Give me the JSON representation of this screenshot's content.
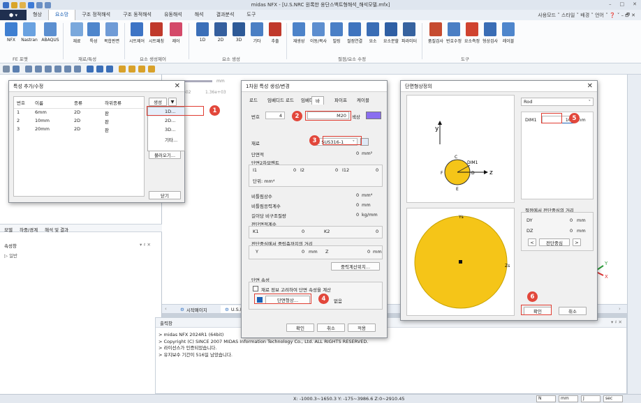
{
  "window": {
    "title": "midas NFX - [U.S.NRC 원록한 옹단스백트형해석_해석모델.mfx]",
    "controls": [
      "–",
      "□",
      "✕"
    ]
  },
  "menu": {
    "logo": "⬢ ▾",
    "tabs": [
      "형상",
      "요소망",
      "구조 정적해석",
      "구조 동적해석",
      "유동해석",
      "해석",
      "결과분석",
      "도구"
    ],
    "active": 1,
    "right": "사용모드 ˅ 스타일 ˅ 배경 ˅ 언어 ˅ ❓ ˅ – 🗗 ✕"
  },
  "ribbon": {
    "buttons": [
      {
        "label": "NFX"
      },
      {
        "label": "Nastran"
      },
      {
        "label": "ABAQUS"
      },
      {
        "label": "재료"
      },
      {
        "label": "특성"
      },
      {
        "label": "복합판면"
      },
      {
        "label": "시트제어"
      },
      {
        "label": "시트패칭"
      },
      {
        "label": "제어"
      },
      {
        "label": "1D"
      },
      {
        "label": "2D"
      },
      {
        "label": "3D"
      },
      {
        "label": "기타"
      },
      {
        "label": "추출"
      },
      {
        "label": "재생성"
      },
      {
        "label": "이동/복사"
      },
      {
        "label": "빌링"
      },
      {
        "label": "절점연결"
      },
      {
        "label": "요소"
      },
      {
        "label": "요소분할"
      },
      {
        "label": "파라미터"
      },
      {
        "label": "품질검사"
      },
      {
        "label": "번호수정"
      },
      {
        "label": "요소측정"
      },
      {
        "label": "형상검사"
      },
      {
        "label": "레이블"
      }
    ],
    "groups": [
      "FE 포맷",
      "재료/특성",
      "요소 생성제어",
      "요소 생성",
      "절점/요소 수정",
      "도구"
    ]
  },
  "left_panel": {
    "tabs": [
      "모델",
      "하중/경계",
      "해석 및 결과"
    ],
    "tree_header": "속성창",
    "tree_items": [
      "일반"
    ],
    "scale_text": "602",
    "scale_value": "1.36e+03",
    "units_hint": "mm"
  },
  "doc_tabs": [
    "시작페이지",
    "U.S.NRC"
  ],
  "output": {
    "header": "출력창",
    "lines": [
      "> midas NFX 2024R1 (64bit)",
      "> Copyright (C) SINCE 2007 MIDAS Information Technology Co., Ltd. ALL RIGHTS RESERVED.",
      "> 라이선스가 인증되었습니다.",
      "> 유지보수 기간이 516일 남았습니다."
    ]
  },
  "status": {
    "coords": "X: -1000.3~1650.3 Y: -175~3986.6 Z:0~2910.45",
    "unit_n": "N",
    "unit_mm": "mm",
    "unit_j": "J",
    "unit_sec": "sec"
  },
  "dlg1": {
    "title": "특성 추가/수정",
    "columns": [
      "번호",
      "이름",
      "종류",
      "하위종류"
    ],
    "rows": [
      {
        "no": "1",
        "name": "6mm",
        "type": "2D",
        "sub": "판"
      },
      {
        "no": "2",
        "name": "10mm",
        "type": "2D",
        "sub": "판"
      },
      {
        "no": "3",
        "name": "20mm",
        "type": "2D",
        "sub": "판"
      }
    ],
    "create_label": "생성",
    "create_arrow": "▼",
    "menu_items": [
      "1D...",
      "2D...",
      "3D...",
      "기타..."
    ],
    "load_label": "불러오기...",
    "close_label": "닫기"
  },
  "dlg2": {
    "title": "1차원 특성 생성/변경",
    "tabs": [
      "로드",
      "임베디드 로드",
      "임베디드 바",
      "파이프",
      "케이블"
    ],
    "active_tab": "바",
    "num_label": "번호",
    "num_value": "4",
    "name_value": "M20",
    "color_label": "색상",
    "material_label": "재료",
    "material_value": "2: SUS316-1",
    "area_label": "단면적",
    "area_value": "0",
    "area_unit": "mm²",
    "moment_title": "단면2차모멘트",
    "i1": "I1",
    "i1v": "0",
    "i2": "I2",
    "i2v": "0",
    "i12": "I12",
    "i12v": "0",
    "unit_row": "단위:   mm⁴",
    "torsion_label": "비틀림상수",
    "torsion_value": "0",
    "torsion_unit": "mm⁴",
    "warp_label": "비틀림응력계수",
    "warp_value": "0",
    "warp_unit": "mm",
    "mass_label": "길이당 비구조질량",
    "mass_value": "0",
    "mass_unit": "kg/mm",
    "shear_title": "전단면적계수",
    "k1": "K1",
    "k1v": "0",
    "k2": "K2",
    "k2v": "0",
    "offset_title": "전단중심에서 중립축까지의 거리",
    "y": "Y",
    "yv": "0",
    "yunit": "mm",
    "z": "Z",
    "zv": "0",
    "zunit": "mm",
    "calc_label": "중력계산위치...",
    "section_title": "단면 속성",
    "checkbox_label": "재료 정보 고려하여 단면 속성을 계산",
    "shape_label": "단면형상...",
    "none_label": "없음",
    "ok": "확인",
    "cancel": "취소",
    "apply": "적용"
  },
  "dlg3": {
    "title": "단면형상정의",
    "shape_value": "Rod",
    "dim_label": "DIM1",
    "dim_value": "10",
    "dim_unit": "mm",
    "axis_y": "y",
    "axis_z": "z",
    "label_c": "C",
    "label_d": "D",
    "label_e": "E",
    "label_f": "F",
    "label_dim": "DIM1",
    "ys": "Ys",
    "zs": "Zs",
    "center_title": "절점에서 전단중심의 거리",
    "dy": "DY",
    "dyv": "0",
    "dz": "DZ",
    "dzv": "0",
    "unit": "mm",
    "shear_center": "전단중심",
    "ok": "확인",
    "cancel": "취소"
  },
  "badges": [
    "1",
    "2",
    "3",
    "4",
    "5",
    "6"
  ],
  "colors": {
    "accent": "#1a5fb4",
    "badge": "#e2473b",
    "rod": "#f5c518",
    "highlight": "#e03c31"
  }
}
